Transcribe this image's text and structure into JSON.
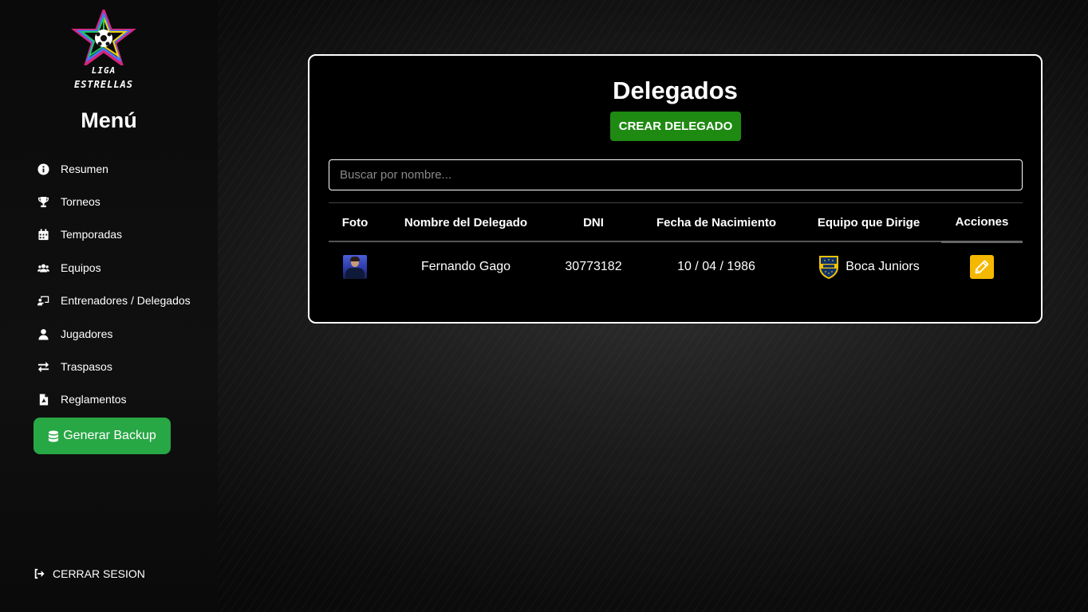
{
  "sidebar": {
    "logo": {
      "line1": "LIGA",
      "line2": "ESTRELLAS"
    },
    "menu_title": "Menú",
    "items": [
      {
        "label": "Resumen",
        "icon": "info-circle-icon"
      },
      {
        "label": "Torneos",
        "icon": "trophy-icon"
      },
      {
        "label": "Temporadas",
        "icon": "calendar-icon"
      },
      {
        "label": "Equipos",
        "icon": "users-icon"
      },
      {
        "label": "Entrenadores / Delegados",
        "icon": "chalkboard-teacher-icon"
      },
      {
        "label": "Jugadores",
        "icon": "user-icon"
      },
      {
        "label": "Traspasos",
        "icon": "exchange-icon"
      },
      {
        "label": "Reglamentos",
        "icon": "file-pdf-icon"
      }
    ],
    "backup_label": "Generar Backup",
    "logout_label": "CERRAR SESION"
  },
  "main": {
    "title": "Delegados",
    "create_label": "CREAR DELEGADO",
    "search_placeholder": "Buscar por nombre...",
    "columns": [
      "Foto",
      "Nombre del Delegado",
      "DNI",
      "Fecha de Nacimiento",
      "Equipo que Dirige",
      "Acciones"
    ],
    "rows": [
      {
        "name": "Fernando Gago",
        "dni": "30773182",
        "birth": "10 / 04 / 1986",
        "team": "Boca Juniors"
      }
    ]
  },
  "colors": {
    "success_green": "#28a745",
    "create_green": "#1e8a12",
    "edit_yellow": "#f5b800",
    "boca_blue": "#0a2f6e",
    "boca_gold": "#f2c200"
  }
}
